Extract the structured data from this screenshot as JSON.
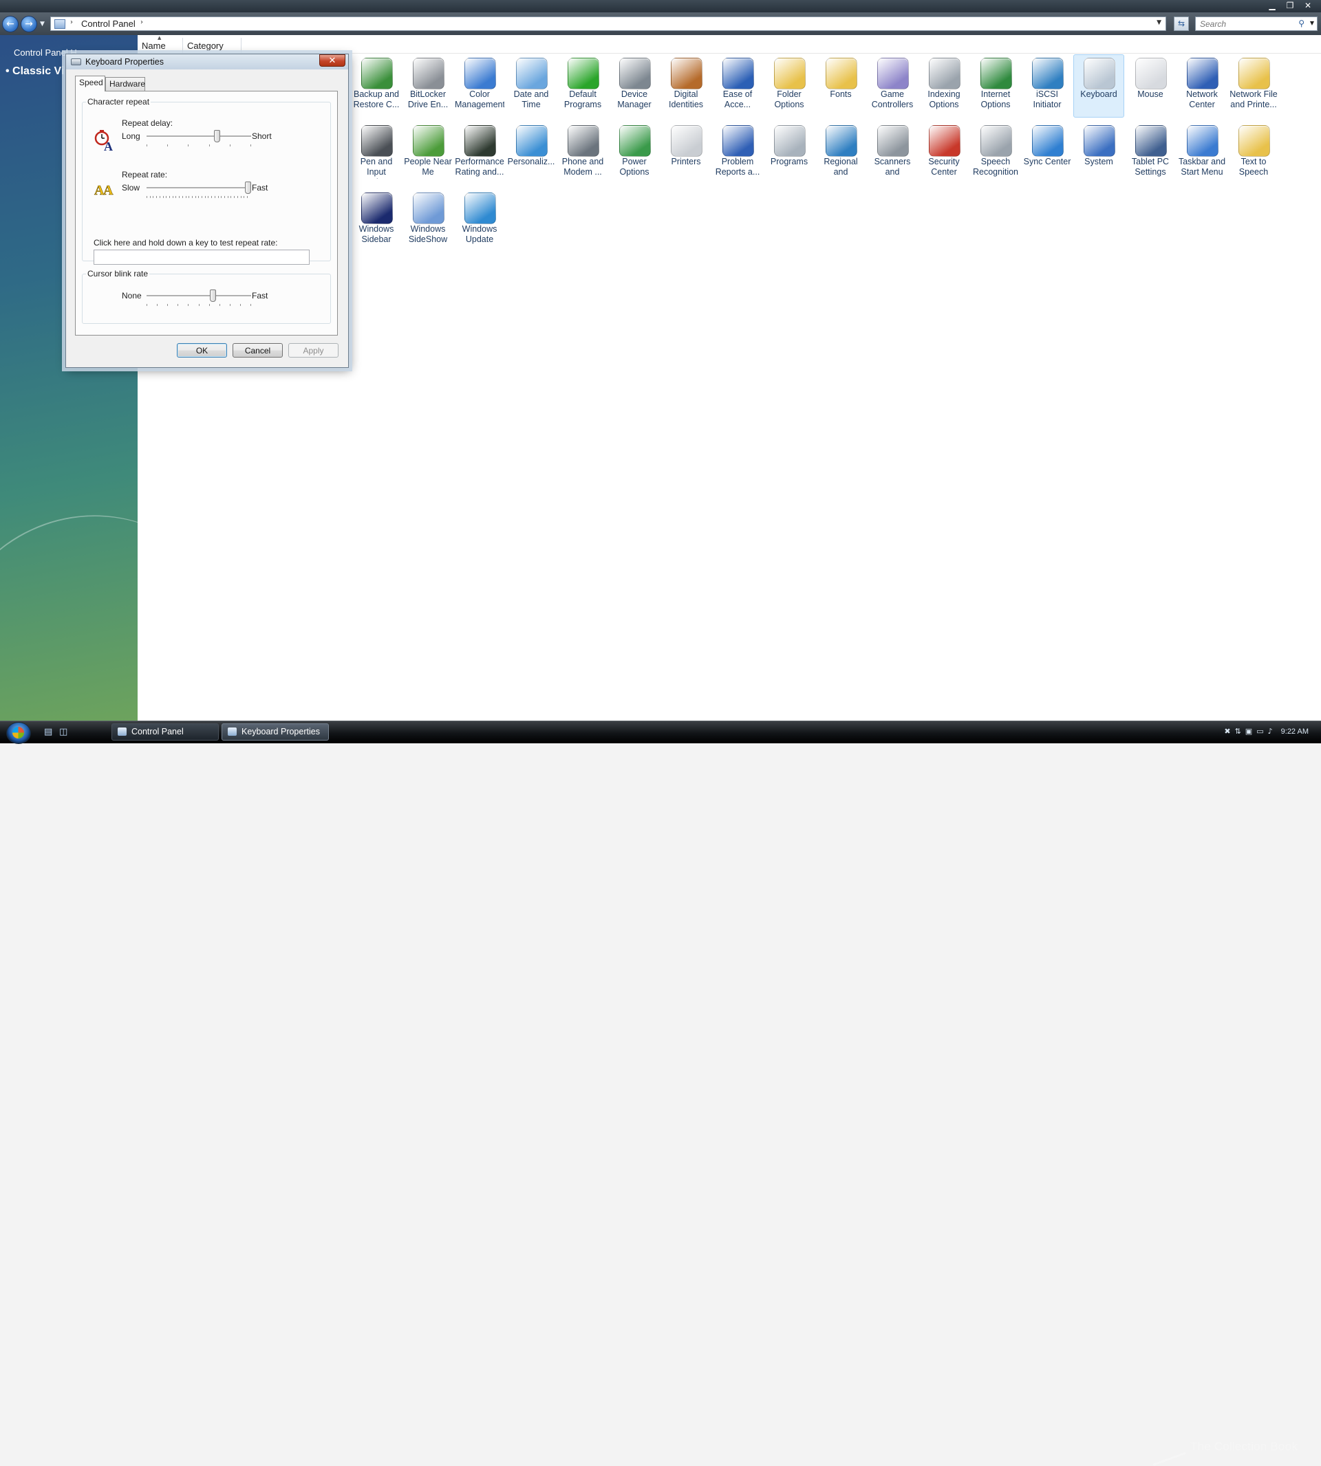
{
  "window": {
    "buttons": {
      "minimize": "▁",
      "restore": "❐",
      "close": "✕"
    }
  },
  "address": {
    "crumb": "Control Panel",
    "separator": "›"
  },
  "search": {
    "placeholder": "Search",
    "icon": "magnifier-icon"
  },
  "taskpane": {
    "home": "Control Panel H",
    "classic": "• Classic Vi"
  },
  "columns": {
    "name": "Name",
    "category": "Category"
  },
  "items": [
    {
      "label": "Backup and Restore C...",
      "icon": "backup-icon",
      "color": "#3a8f3a"
    },
    {
      "label": "BitLocker Drive En...",
      "icon": "bitlocker-icon",
      "color": "#8a8f96"
    },
    {
      "label": "Color Management",
      "icon": "color-mgmt-icon",
      "color": "#3b7bd1"
    },
    {
      "label": "Date and Time",
      "icon": "clock-icon",
      "color": "#6aa6de"
    },
    {
      "label": "Default Programs",
      "icon": "default-programs-icon",
      "color": "#2aa52a"
    },
    {
      "label": "Device Manager",
      "icon": "device-manager-icon",
      "color": "#7d8790"
    },
    {
      "label": "Digital Identities",
      "icon": "digital-identity-icon",
      "color": "#b56a2a"
    },
    {
      "label": "Ease of Acce...",
      "icon": "ease-access-icon",
      "color": "#2b5fb5"
    },
    {
      "label": "Folder Options",
      "icon": "folder-options-icon",
      "color": "#e8c14a"
    },
    {
      "label": "Fonts",
      "icon": "fonts-icon",
      "color": "#e8c14a"
    },
    {
      "label": "Game Controllers",
      "icon": "gamepad-icon",
      "color": "#8d84c9"
    },
    {
      "label": "Indexing Options",
      "icon": "indexing-icon",
      "color": "#9aa3ac"
    },
    {
      "label": "Internet Options",
      "icon": "internet-icon",
      "color": "#2f8a3e"
    },
    {
      "label": "iSCSI Initiator",
      "icon": "iscsi-icon",
      "color": "#2f7fc1"
    },
    {
      "label": "Keyboard",
      "icon": "keyboard-icon",
      "color": "#b9c6d3",
      "selected": true
    },
    {
      "label": "Mouse",
      "icon": "mouse-icon",
      "color": "#d7dadf"
    },
    {
      "label": "Network Center",
      "icon": "network-icon",
      "color": "#2f5fb5"
    },
    {
      "label": "Network File and Printe...",
      "icon": "network-file-icon",
      "color": "#e8c14a"
    },
    {
      "label": "Pen and Input Devices",
      "icon": "pen-icon",
      "color": "#4a4f55"
    },
    {
      "label": "People Near Me",
      "icon": "people-icon",
      "color": "#4c9c3a"
    },
    {
      "label": "Performance Rating and...",
      "icon": "performance-icon",
      "color": "#2e3a30"
    },
    {
      "label": "Personaliz...",
      "icon": "personalize-icon",
      "color": "#3b8fd4"
    },
    {
      "label": "Phone and Modem ...",
      "icon": "phone-icon",
      "color": "#6b747d"
    },
    {
      "label": "Power Options",
      "icon": "power-icon",
      "color": "#3a9a4a"
    },
    {
      "label": "Printers",
      "icon": "printer-icon",
      "color": "#c9cdd2"
    },
    {
      "label": "Problem Reports a...",
      "icon": "problem-reports-icon",
      "color": "#2f5fb5"
    },
    {
      "label": "Programs",
      "icon": "programs-icon",
      "color": "#a8b2bc"
    },
    {
      "label": "Regional and Language ...",
      "icon": "globe-icon",
      "color": "#2f7fc1"
    },
    {
      "label": "Scanners and Cameras",
      "icon": "scanner-icon",
      "color": "#8d959d"
    },
    {
      "label": "Security Center",
      "icon": "shield-icon",
      "color": "#c8382a"
    },
    {
      "label": "Speech Recognition",
      "icon": "microphone-icon",
      "color": "#9aa3ac"
    },
    {
      "label": "Sync Center",
      "icon": "sync-icon",
      "color": "#2f7fd1"
    },
    {
      "label": "System",
      "icon": "system-icon",
      "color": "#3b6fc1"
    },
    {
      "label": "Tablet PC Settings",
      "icon": "tablet-icon",
      "color": "#3f5f8f"
    },
    {
      "label": "Taskbar and Start Menu",
      "icon": "taskbar-icon",
      "color": "#3b7bd1"
    },
    {
      "label": "Text to Speech",
      "icon": "text-speech-icon",
      "color": "#e8c14a"
    },
    {
      "label": "Windows Sidebar",
      "icon": "sidebar-icon",
      "color": "#1b2a6e"
    },
    {
      "label": "Windows SideShow",
      "icon": "sideshow-icon",
      "color": "#6f9ad6"
    },
    {
      "label": "Windows Update",
      "icon": "windows-update-icon",
      "color": "#2f8ad1"
    }
  ],
  "dialog": {
    "title": "Keyboard Properties",
    "close": "✕",
    "tabs": {
      "speed": "Speed",
      "hardware": "Hardware"
    },
    "character_repeat": {
      "legend": "Character repeat",
      "delay_label": "Repeat delay:",
      "delay_min": "Long",
      "delay_max": "Short",
      "delay_value": 0.67,
      "rate_label": "Repeat rate:",
      "rate_min": "Slow",
      "rate_max": "Fast",
      "rate_value": 1.0,
      "test_label": "Click here and hold down a key to test repeat rate:",
      "test_value": ""
    },
    "cursor_blink": {
      "legend": "Cursor blink rate",
      "min": "None",
      "max": "Fast",
      "value": 0.63
    },
    "buttons": {
      "ok": "OK",
      "cancel": "Cancel",
      "apply": "Apply"
    }
  },
  "taskbar": {
    "tasks": [
      {
        "label": "Control Panel"
      },
      {
        "label": "Keyboard Properties",
        "active": true
      }
    ],
    "watermark": "The Collection Book",
    "clock": "9:22 AM"
  }
}
